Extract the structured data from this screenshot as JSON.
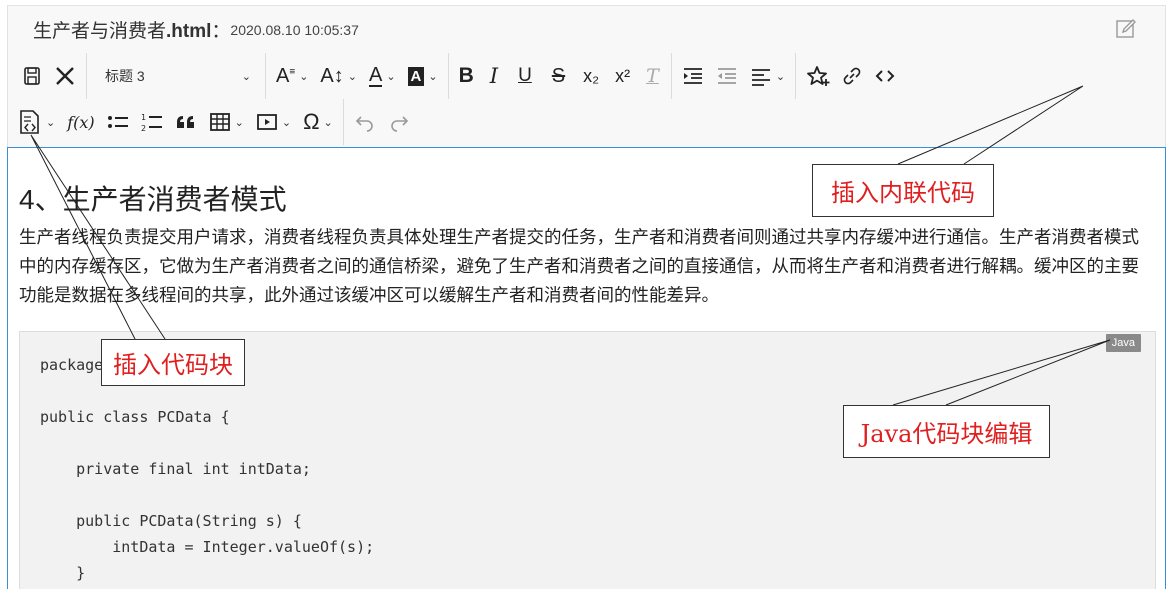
{
  "header": {
    "title": "生产者与消费者",
    "extension": ".html",
    "separator": "：",
    "timestamp": "2020.08.10 10:05:37"
  },
  "toolbar": {
    "save_icon": "save-icon",
    "close_icon": "close-icon",
    "format_select": "标题 3",
    "row1_icons": [
      "font-family-icon",
      "font-size-icon",
      "text-color-icon",
      "background-color-icon",
      "bold-icon",
      "italic-icon",
      "underline-icon",
      "strikethrough-icon",
      "subscript-icon",
      "superscript-icon",
      "clear-format-icon",
      "indent-icon",
      "outdent-icon",
      "align-icon",
      "star-icon",
      "link-icon",
      "inline-code-icon"
    ],
    "row2_icons": [
      "code-block-icon",
      "formula-icon",
      "bullet-list-icon",
      "numbered-list-icon",
      "quote-icon",
      "table-icon",
      "media-icon",
      "special-char-icon",
      "undo-icon",
      "redo-icon"
    ],
    "formula_label": "f(x)",
    "special_char_label": "Ω",
    "bold_label": "B",
    "italic_label": "I",
    "underline_label": "U",
    "strike_label": "S",
    "sub_label": "x₂",
    "sup_label": "x²",
    "clear_label": "T"
  },
  "content": {
    "heading": "4、生产者消费者模式",
    "paragraph": "生产者线程负责提交用户请求，消费者线程负责具体处理生产者提交的任务，生产者和消费者间则通过共享内存缓冲进行通信。生产者消费者模式中的内存缓存区，它做为生产者消费者之间的通信桥梁，避免了生产者和消费者之间的直接通信，从而将生产者和消费者进行解耦。缓冲区的主要功能是数据在多线程间的共享，此外通过该缓冲区可以缓解生产者和消费者间的性能差异。",
    "code_lang": "Java",
    "code_lines": [
      "package ......n;",
      "public class PCData {",
      "    private final int intData;",
      "    public PCData(String s) {",
      "        intData = Integer.valueOf(s);",
      "    }"
    ]
  },
  "annotations": {
    "inline_code": "插入内联代码",
    "code_block": "插入代码块",
    "java_block": "Java代码块编辑"
  },
  "colors": {
    "annotation_text": "#e02020",
    "editor_border": "#3b8fd6"
  }
}
